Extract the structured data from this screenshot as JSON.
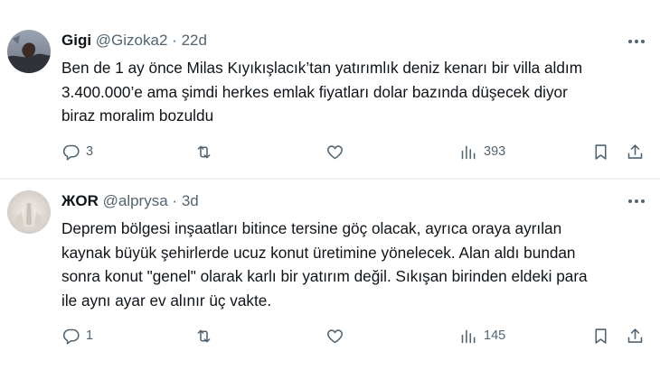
{
  "tweets": [
    {
      "author_name": "Gigi",
      "handle": "@Gizoka2",
      "separator": "·",
      "time": "22d",
      "text_lines": [
        "Ben de 1 ay önce Milas Kıyıkışlacık’tan yatırımlık deniz kenarı bir villa aldım",
        "3.400.000’e ama şimdi herkes emlak fiyatları dolar bazında düşecek diyor",
        "biraz moralim bozuldu"
      ],
      "reply_count": "3",
      "retweet_count": "",
      "like_count": "",
      "view_count": "393"
    },
    {
      "author_name": "ЖOR",
      "handle": "@alprysa",
      "separator": "·",
      "time": "3d",
      "text_lines": [
        "Deprem bölgesi inşaatları bitince tersine göç olacak, ayrıca oraya ayrılan",
        "kaynak büyük şehirlerde ucuz konut üretimine yönelecek. Alan aldı bundan",
        "sonra konut \"genel\" olarak karlı bir yatırım değil. Sıkışan birinden eldeki para",
        "ile aynı ayar ev alınır üç vakte."
      ],
      "reply_count": "1",
      "retweet_count": "",
      "like_count": "",
      "view_count": "145"
    }
  ],
  "icons": {
    "reply": "reply-icon",
    "retweet": "retweet-icon",
    "like": "like-icon",
    "views": "views-icon",
    "bookmark": "bookmark-icon",
    "share": "share-icon",
    "more": "more-options-icon"
  },
  "colors": {
    "text_primary": "#0f1419",
    "text_secondary": "#536471",
    "divider": "#eff3f4",
    "background": "#ffffff"
  }
}
